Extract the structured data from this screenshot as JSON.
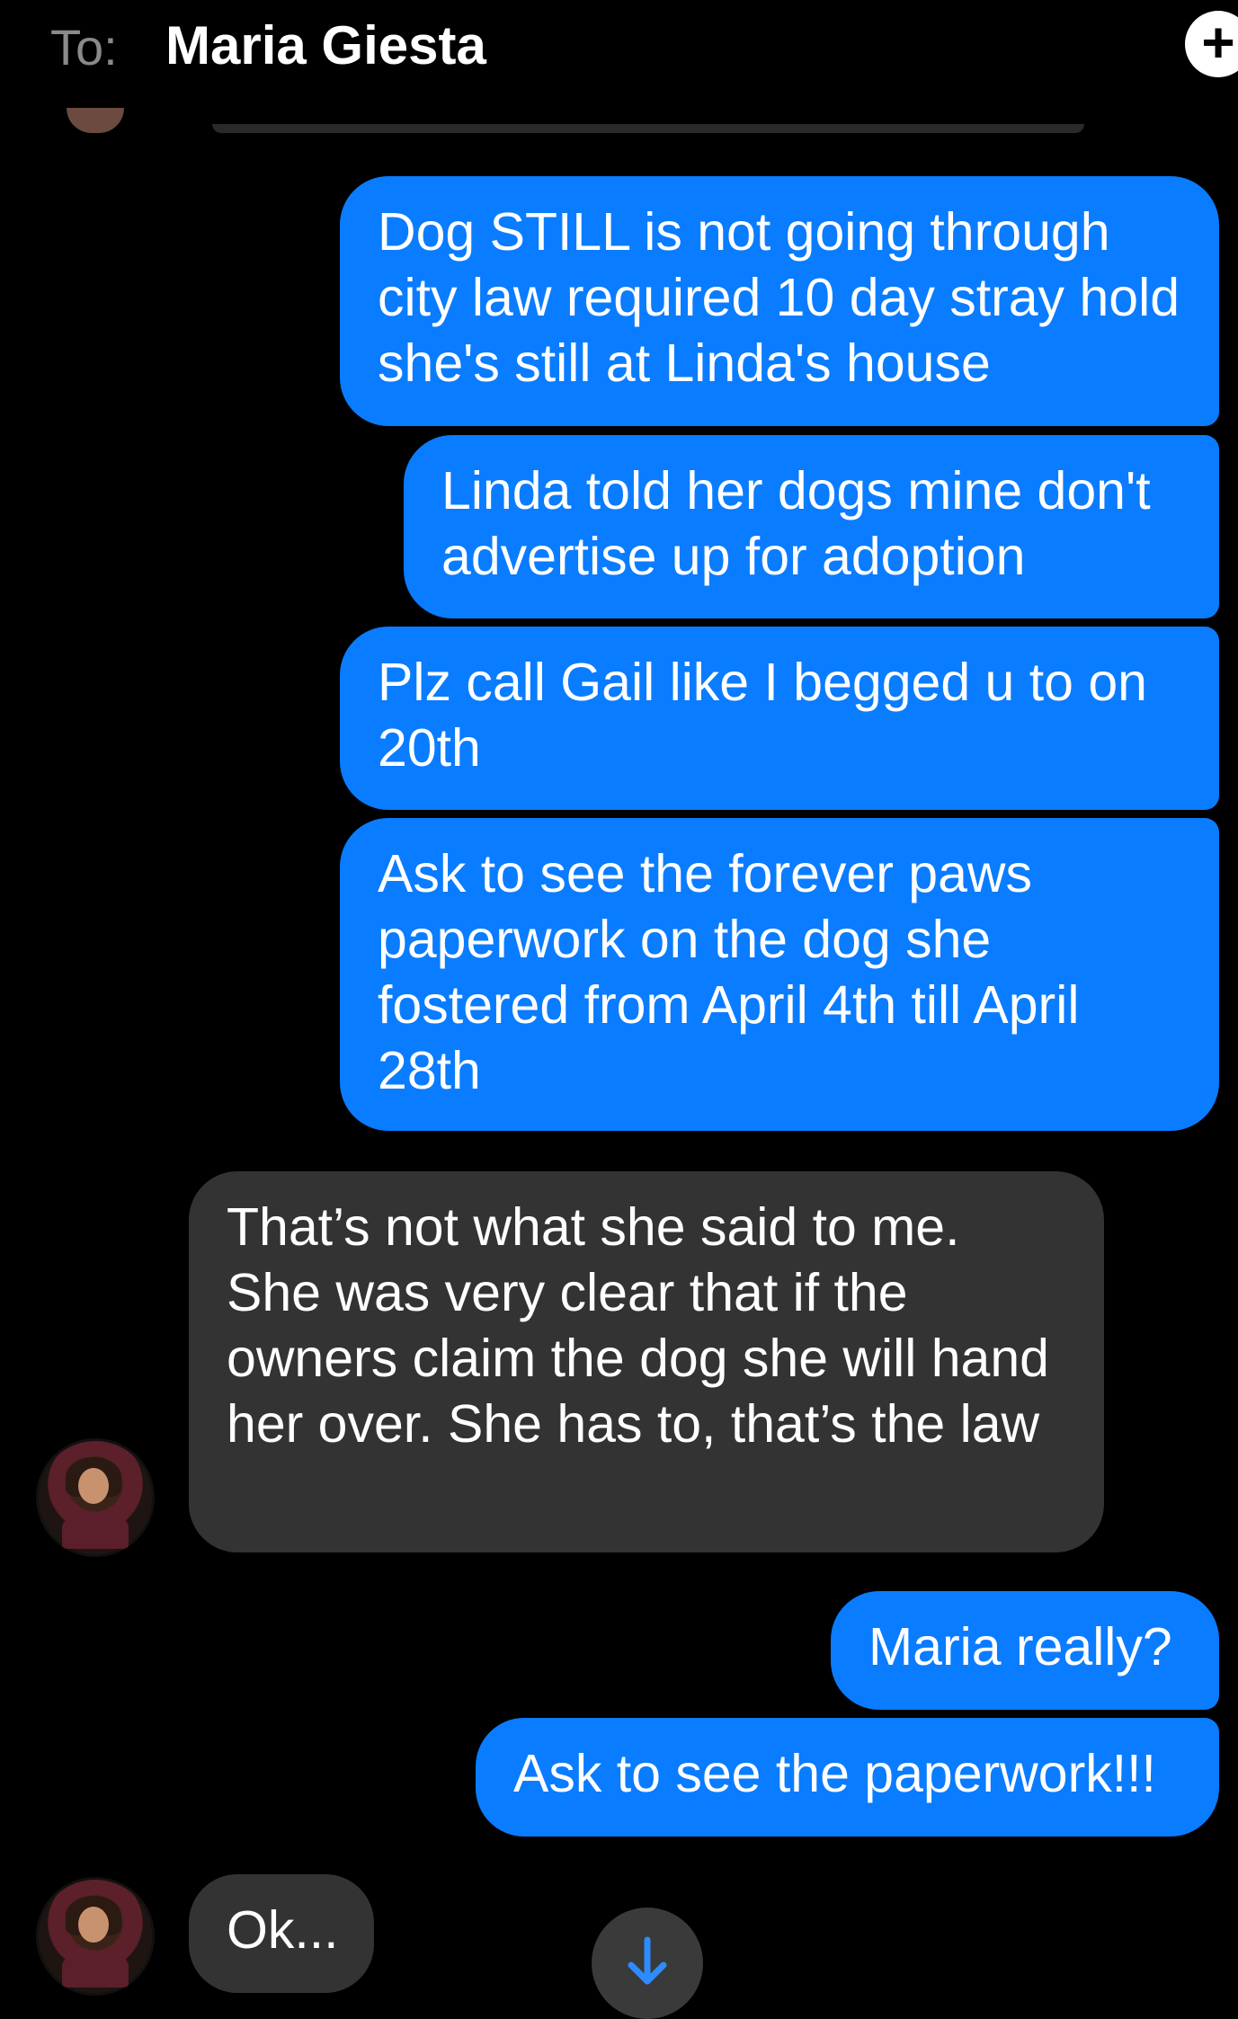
{
  "header": {
    "to_label": "To:",
    "recipient": "Maria Giesta",
    "add_icon": "plus-icon"
  },
  "colors": {
    "outgoing_bubble": "#0a7cff",
    "incoming_bubble": "#333333",
    "background": "#000000"
  },
  "messages": [
    {
      "direction": "outgoing",
      "text": "Dog STILL is not going through city law required 10 day stray hold she's still at Linda's house"
    },
    {
      "direction": "outgoing",
      "text": "Linda told her dogs mine don't advertise up for adoption"
    },
    {
      "direction": "outgoing",
      "text": "Plz call Gail like I begged u to on 20th"
    },
    {
      "direction": "outgoing",
      "text": "Ask to see the forever paws paperwork on the dog she fostered  from April 4th till April 28th"
    },
    {
      "direction": "incoming",
      "text": "That’s not what she said to me.  She was very clear that if the owners claim the dog she will hand her over.  She has to, that’s the law"
    },
    {
      "direction": "outgoing",
      "text": "Maria really?"
    },
    {
      "direction": "outgoing",
      "text": "Ask to see the paperwork!!!"
    },
    {
      "direction": "incoming",
      "text": "Ok..."
    }
  ],
  "scroll_button_icon": "arrow-down-icon"
}
